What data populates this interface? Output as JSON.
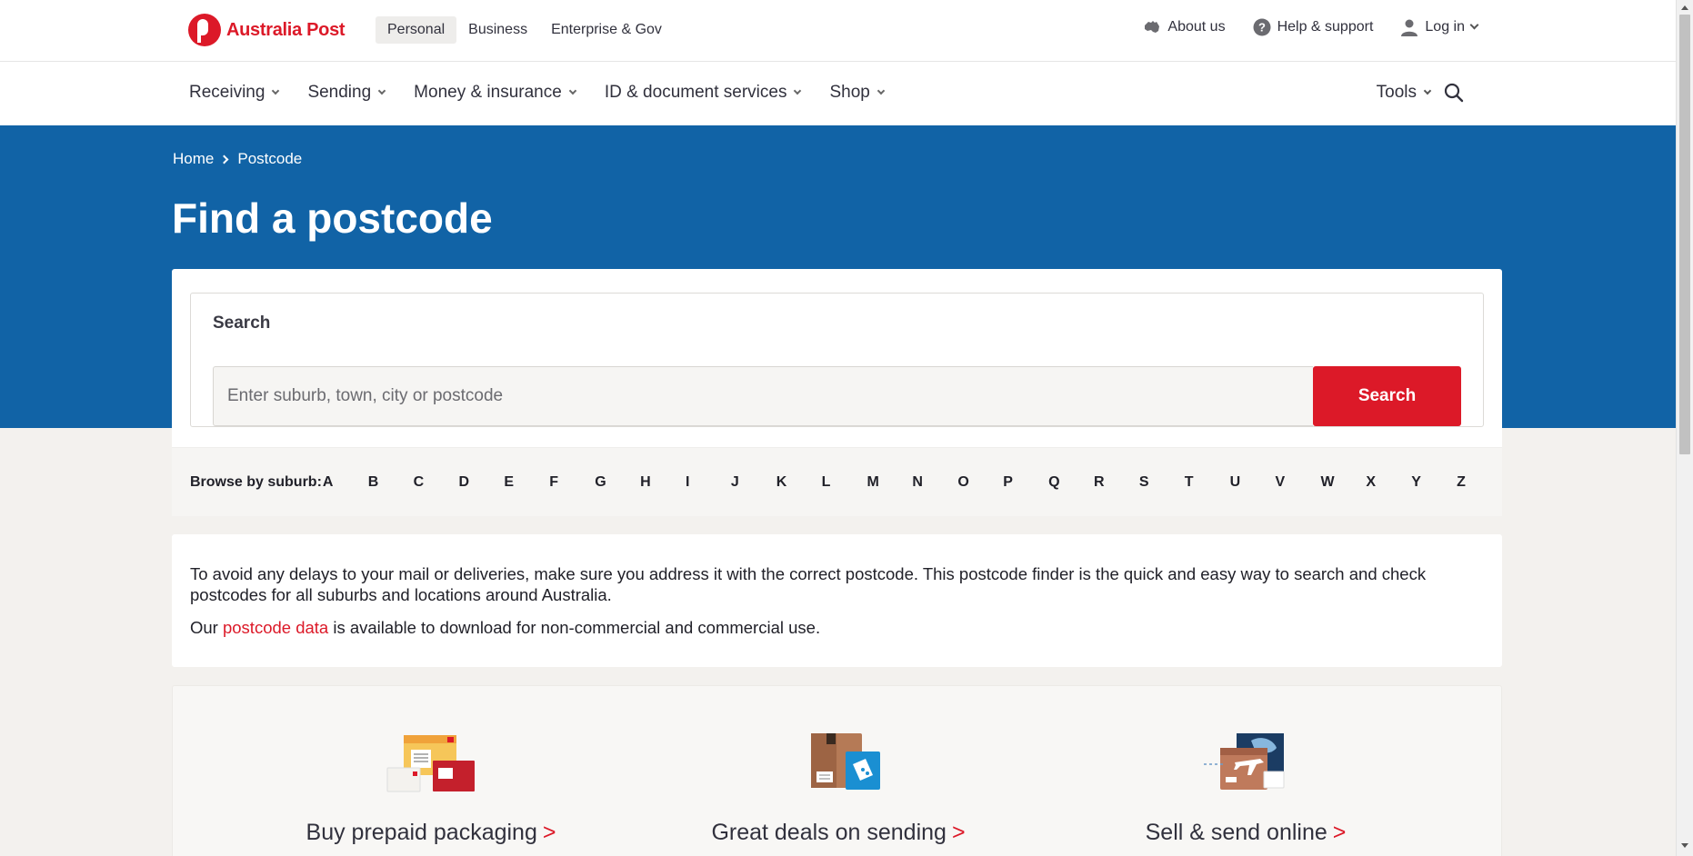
{
  "brand": {
    "name": "Australia Post",
    "color": "#dc1928",
    "hero_color": "#1163a6"
  },
  "topbar": {
    "segments": [
      "Personal",
      "Business",
      "Enterprise & Gov"
    ],
    "active_segment": "Personal",
    "about_label": "About us",
    "help_label": "Help & support",
    "login_label": "Log in"
  },
  "nav": {
    "items": [
      "Receiving",
      "Sending",
      "Money & insurance",
      "ID & document services",
      "Shop"
    ],
    "tools_label": "Tools"
  },
  "breadcrumb": {
    "home": "Home",
    "current": "Postcode"
  },
  "hero": {
    "title": "Find a postcode"
  },
  "search": {
    "label": "Search",
    "placeholder": "Enter suburb, town, city or postcode",
    "value": "",
    "button_label": "Search"
  },
  "browse": {
    "label": "Browse by suburb:",
    "letters": [
      "A",
      "B",
      "C",
      "D",
      "E",
      "F",
      "G",
      "H",
      "I",
      "J",
      "K",
      "L",
      "M",
      "N",
      "O",
      "P",
      "Q",
      "R",
      "S",
      "T",
      "U",
      "V",
      "W",
      "X",
      "Y",
      "Z"
    ]
  },
  "info": {
    "paragraph1": "To avoid any delays to your mail or deliveries, make sure you address it with the correct postcode. This postcode finder is the quick and easy way to search and check postcodes for all suburbs and locations around Australia.",
    "p2_prefix": "Our ",
    "p2_link": "postcode data",
    "p2_suffix": " is available to download for non-commercial and commercial use."
  },
  "promos": [
    {
      "title": "Buy prepaid packaging",
      "arrow": ">",
      "icon": "prepaid-packaging-illustration"
    },
    {
      "title": "Great deals on sending",
      "arrow": ">",
      "icon": "parcel-tag-illustration"
    },
    {
      "title": "Sell & send online",
      "arrow": ">",
      "icon": "plane-parcel-illustration"
    }
  ]
}
